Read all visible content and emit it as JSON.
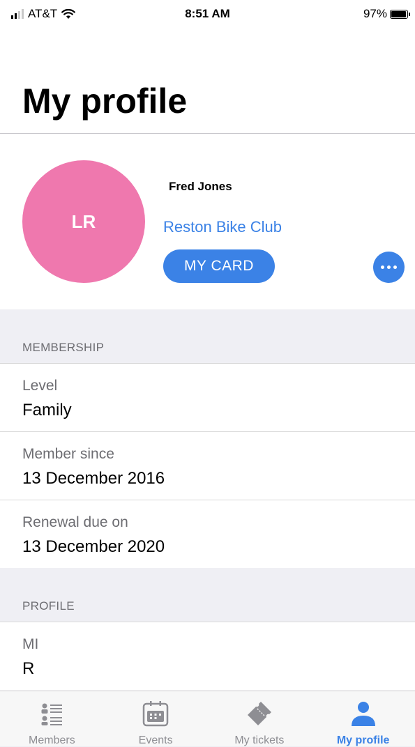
{
  "status_bar": {
    "carrier": "AT&T",
    "time": "8:51 AM",
    "battery": "97%"
  },
  "header": {
    "title": "My profile"
  },
  "profile": {
    "initials": "LR",
    "avatar_color": "#ef78ae",
    "name": "Fred Jones",
    "club": "Reston Bike Club",
    "card_button": "MY CARD"
  },
  "membership": {
    "section_title": "MEMBERSHIP",
    "rows": [
      {
        "label": "Level",
        "value": "Family"
      },
      {
        "label": "Member since",
        "value": "13 December 2016"
      },
      {
        "label": "Renewal due on",
        "value": "13 December 2020"
      }
    ]
  },
  "profile_section": {
    "section_title": "PROFILE",
    "rows": [
      {
        "label": "MI",
        "value": "R"
      }
    ]
  },
  "tab_bar": {
    "tabs": [
      {
        "label": "Members",
        "icon": "members-list-icon"
      },
      {
        "label": "Events",
        "icon": "calendar-icon"
      },
      {
        "label": "My tickets",
        "icon": "ticket-icon"
      },
      {
        "label": "My profile",
        "icon": "person-icon",
        "active": true
      }
    ]
  },
  "colors": {
    "accent": "#3b82e6",
    "inactive": "#8e8e93"
  }
}
